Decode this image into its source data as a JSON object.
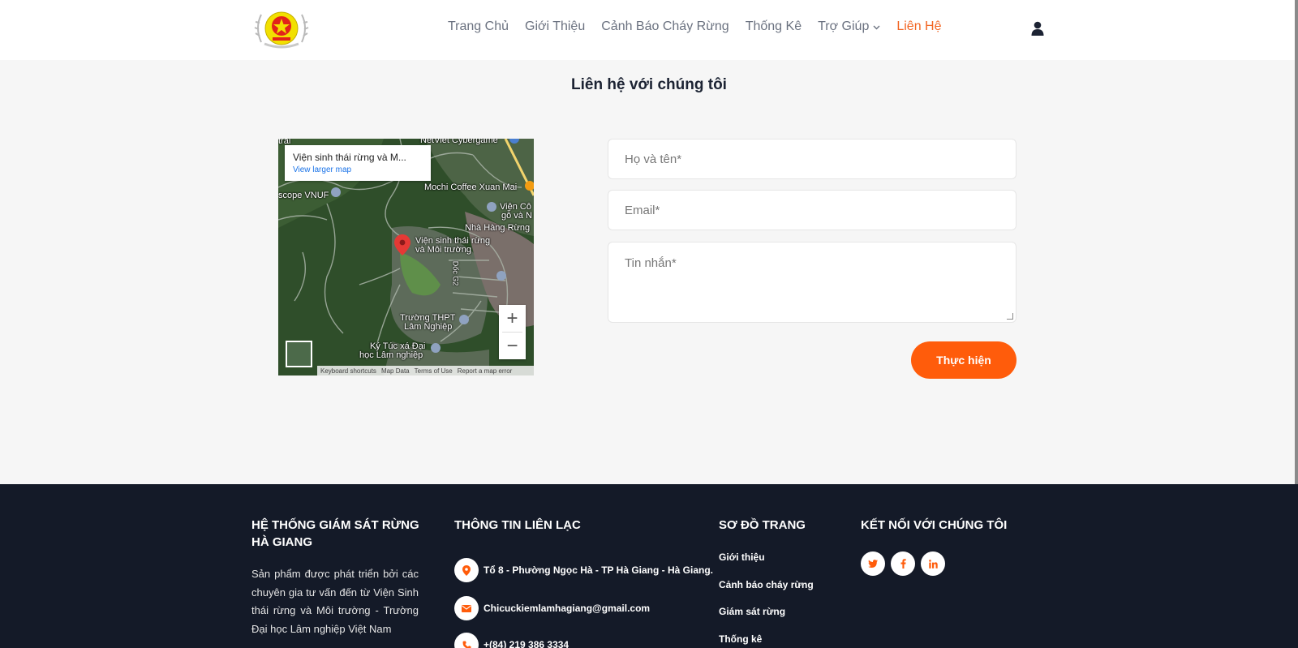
{
  "header": {
    "nav": [
      {
        "label": "Trang Chủ"
      },
      {
        "label": "Giới Thiệu"
      },
      {
        "label": "Cảnh Báo Cháy Rừng"
      },
      {
        "label": "Thống Kê"
      },
      {
        "label": "Trợ Giúp"
      },
      {
        "label": "Liên Hệ"
      }
    ],
    "active_tab": "Liên Hệ",
    "accent_color": "#f26522"
  },
  "page": {
    "title": "Liên hệ với chúng tôi"
  },
  "map": {
    "place_name": "Viện sinh thái rừng và M...",
    "view_larger": "View larger map",
    "labels": {
      "netviet": "NetViet Cybergame",
      "mochi": "Mochi Coffee Xuan Mai",
      "scope": "scope VNUF",
      "vien_co": "Viện Cô",
      "go_va": "gỗ và N",
      "nha_hang": "Nhà Hàng Rừng",
      "marker_1": "Viện sinh thái rừng",
      "marker_2": "và Môi trường",
      "doc": "Dốc G2",
      "truong_1": "Trường THPT",
      "truong_2": "Lâm Nghiệp",
      "ktx_1": "Ký Túc xá Đại",
      "ktx_2": "học Lâm nghiệp",
      "tral": "tral"
    },
    "footer": [
      "Keyboard shortcuts",
      "Map Data",
      "Terms of Use",
      "Report a map error"
    ],
    "zoom_in": "+",
    "zoom_out": "−"
  },
  "form": {
    "name_placeholder": "Họ và tên*",
    "email_placeholder": "Email*",
    "message_placeholder": "Tin nhắn*",
    "submit_label": "Thực hiện",
    "submit_color": "#ff5c0b"
  },
  "footer": {
    "about_title": "HỆ THỐNG GIÁM SÁT RỪNG HÀ GIANG",
    "about_text": "Sản phẩm được phát triển bởi các chuyên gia tư vấn đến từ Viện Sinh thái rừng và Môi trường - Trường Đại học Lâm nghiệp Việt Nam",
    "contact_title": "THÔNG TIN LIÊN LẠC",
    "contacts": [
      {
        "icon": "map-marker-icon",
        "text": "Tổ 8 - Phường Ngọc Hà - TP Hà Giang - Hà Giang."
      },
      {
        "icon": "envelope-icon",
        "text": "Chicuckiemlamhagiang@gmail.com"
      },
      {
        "icon": "phone-icon",
        "text": "+(84) 219 386 3334"
      }
    ],
    "sitemap_title": "SƠ ĐỒ TRANG",
    "sitemap": [
      {
        "label": "Giới thiệu"
      },
      {
        "label": "Cảnh báo cháy rừng"
      },
      {
        "label": "Giám sát rừng"
      },
      {
        "label": "Thống kê"
      }
    ],
    "social_title": "KẾT NỐI VỚI CHÚNG TÔI",
    "social": [
      {
        "icon": "twitter-icon"
      },
      {
        "icon": "facebook-icon"
      },
      {
        "icon": "linkedin-icon"
      }
    ],
    "background": "#141a28"
  }
}
